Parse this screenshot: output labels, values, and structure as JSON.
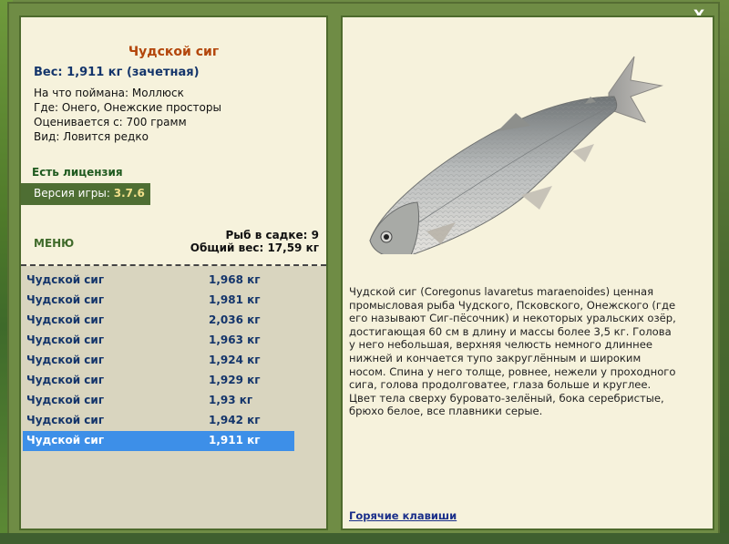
{
  "window": {
    "close_label": "X"
  },
  "fish": {
    "name": "Чудской сиг",
    "weight_line": "Вес: 1,911 кг (зачетная)",
    "info": [
      "На что поймана: Моллюск",
      "Где: Онего, Онежские просторы",
      "Оценивается с: 700 грамм",
      "Вид: Ловится редко"
    ],
    "license": "Есть лицензия"
  },
  "version": {
    "label": "Версия игры:",
    "number": "3.7.6"
  },
  "menu_label": "МЕНЮ",
  "cage": {
    "count": "Рыб в садке: 9",
    "total": "Общий вес: 17,59 кг"
  },
  "catch_list": [
    {
      "name": "Чудской сиг",
      "weight": "1,968 кг"
    },
    {
      "name": "Чудской сиг",
      "weight": "1,981 кг"
    },
    {
      "name": "Чудской сиг",
      "weight": "2,036 кг"
    },
    {
      "name": "Чудской сиг",
      "weight": "1,963 кг"
    },
    {
      "name": "Чудской сиг",
      "weight": "1,924 кг"
    },
    {
      "name": "Чудской сиг",
      "weight": "1,929 кг"
    },
    {
      "name": "Чудской сиг",
      "weight": "1,93 кг"
    },
    {
      "name": "Чудской сиг",
      "weight": "1,942 кг"
    },
    {
      "name": "Чудской сиг",
      "weight": "1,911 кг",
      "selected": true
    }
  ],
  "description": "Чудской сиг (Coregonus lavaretus maraenoides) ценная промысловая рыба Чудского, Псковского, Онежского (где его называют Сиг-пёсочник) и некоторых уральских озёр, достигающая 60 см в длину и массы более 3,5 кг. Голова у него небольшая, верхняя челюсть немного длиннее нижней и кончается тупо закруглённым и широким носом. Спина у него толще, ровнее, нежели у проходного сига, голова продолговатее, глаза больше и круглее. Цвет тела сверху буровато-зелёный, бока серебристые, брюхо белое, все плавники серые.",
  "hotkeys_label": "Горячие клавиши",
  "colors": {
    "frame": "#6f8c45",
    "panel": "#f6f2dc",
    "fish_name": "#b3460b",
    "list_text": "#14356b",
    "selected_row": "#3d8fe8",
    "version_bg": "#4e6e33"
  },
  "icons": {
    "close": "close-icon"
  }
}
